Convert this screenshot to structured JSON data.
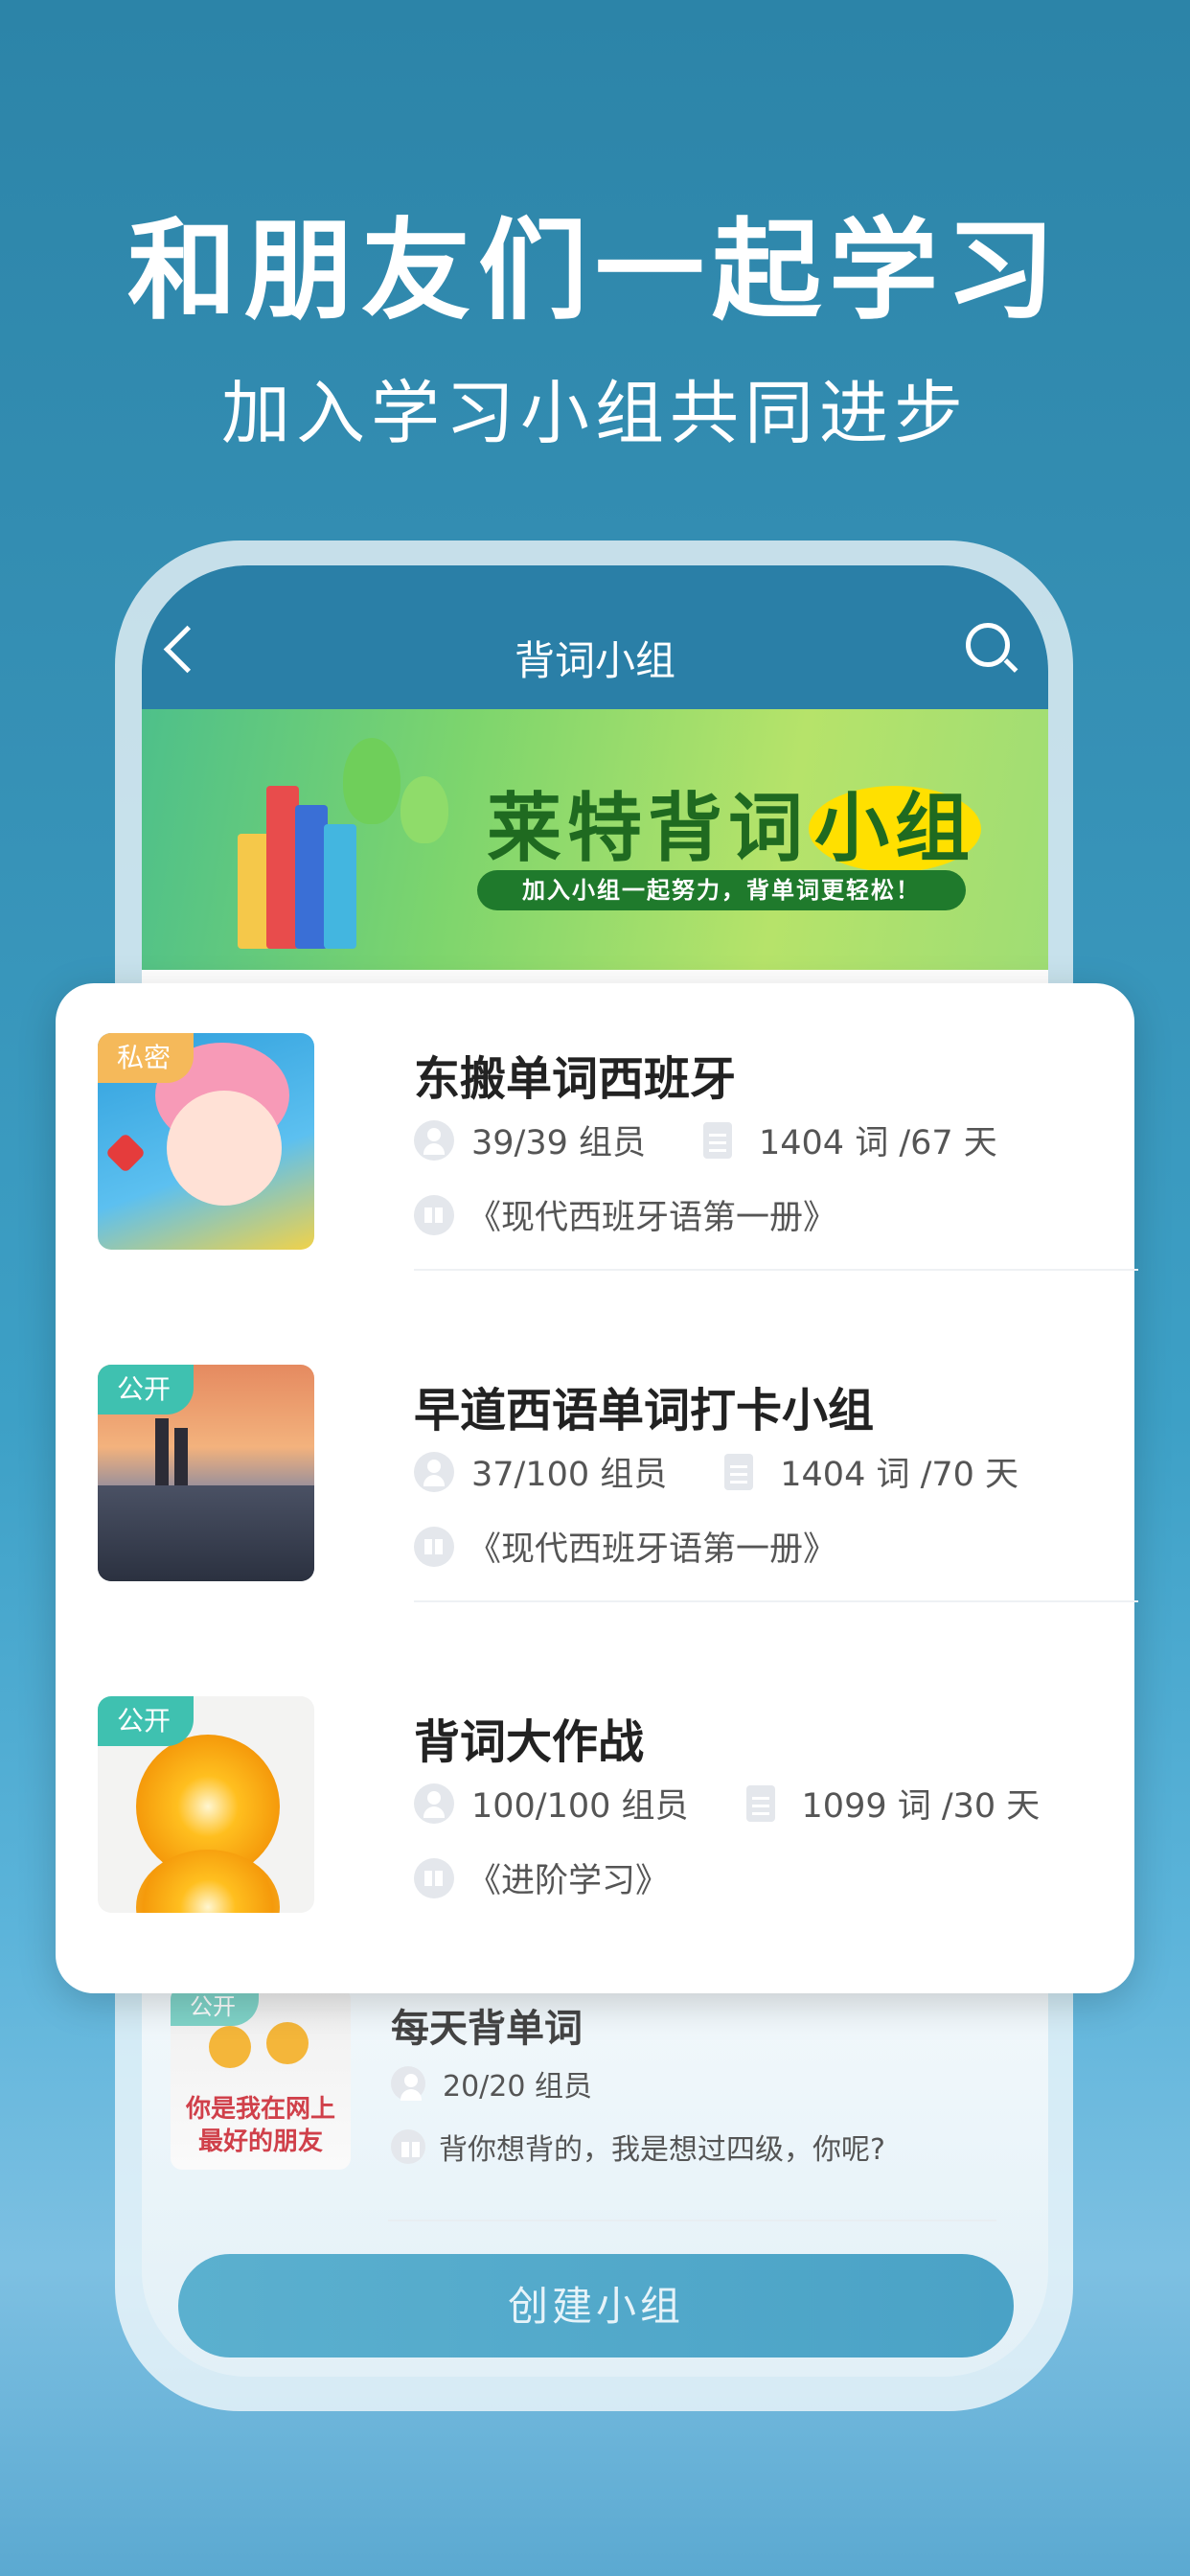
{
  "hero": {
    "title": "和朋友们一起学习",
    "subtitle": "加入学习小组共同进步"
  },
  "nav": {
    "title": "背词小组",
    "back_icon": "chevron-left-icon",
    "search_icon": "search-icon"
  },
  "banner": {
    "title_part1": "莱特背词",
    "title_highlight": "小组",
    "slogan": "加入小组一起努力，背单词更轻松！"
  },
  "groups": [
    {
      "tag": "私密",
      "tag_color": "#f5b95a",
      "name": "东搬单词西班牙",
      "members": "39/39 组员",
      "progress": "1404 词 /67 天",
      "book": "《现代西班牙语第一册》"
    },
    {
      "tag": "公开",
      "tag_color": "#3fc1b0",
      "name": "早道西语单词打卡小组",
      "members": "37/100 组员",
      "progress": "1404 词 /70 天",
      "book": "《现代西班牙语第一册》"
    },
    {
      "tag": "公开",
      "tag_color": "#3fc1b0",
      "name": "背词大作战",
      "members": "100/100 组员",
      "progress": "1099 词 /30 天",
      "book": "《进阶学习》"
    }
  ],
  "faded_group": {
    "tag": "公开",
    "name": "每天背单词",
    "members": "20/20 组员",
    "description": "背你想背的，我是想过四级，你呢?",
    "thumb_caption_line1": "你是我在网上",
    "thumb_caption_line2": "最好的朋友"
  },
  "create_button": "创建小组"
}
